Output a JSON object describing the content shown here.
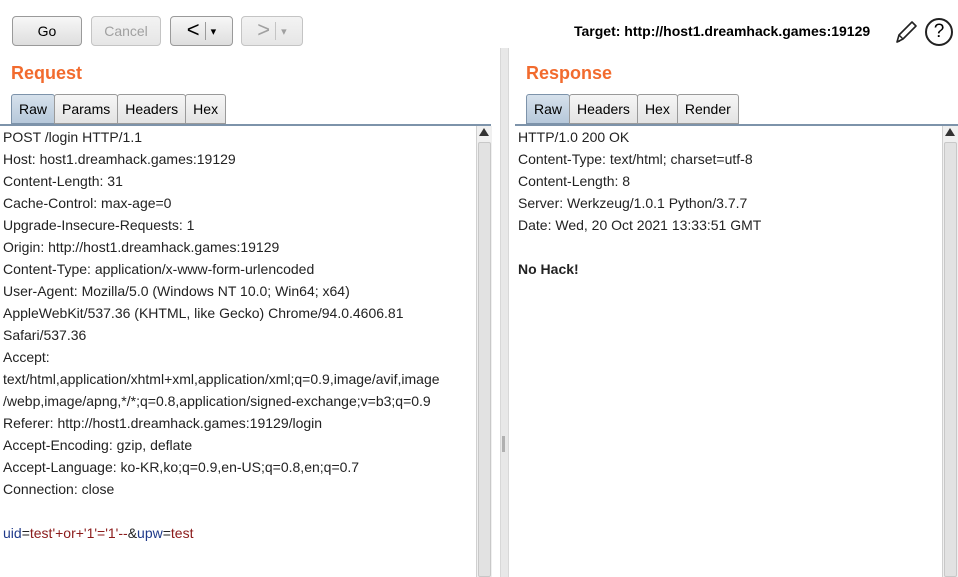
{
  "toolbar": {
    "go_label": "Go",
    "cancel_label": "Cancel",
    "back_arrow": "<",
    "forward_arrow": ">",
    "dropdown_glyph": "▾",
    "target_label": "Target: http://host1.dreamhack.games:19129"
  },
  "request": {
    "title": "Request",
    "tabs": [
      "Raw",
      "Params",
      "Headers",
      "Hex"
    ],
    "active_tab": "Raw",
    "lines": [
      "POST /login HTTP/1.1",
      "Host: host1.dreamhack.games:19129",
      "Content-Length: 31",
      "Cache-Control: max-age=0",
      "Upgrade-Insecure-Requests: 1",
      "Origin: http://host1.dreamhack.games:19129",
      "Content-Type: application/x-www-form-urlencoded",
      "User-Agent: Mozilla/5.0 (Windows NT 10.0; Win64; x64)",
      "AppleWebKit/537.36 (KHTML, like Gecko) Chrome/94.0.4606.81",
      "Safari/537.36",
      "Accept:",
      "text/html,application/xhtml+xml,application/xml;q=0.9,image/avif,image",
      "/webp,image/apng,*/*;q=0.8,application/signed-exchange;v=b3;q=0.9",
      "Referer: http://host1.dreamhack.games:19129/login",
      "Accept-Encoding: gzip, deflate",
      "Accept-Language: ko-KR,ko;q=0.9,en-US;q=0.8,en;q=0.7",
      "Connection: close",
      ""
    ],
    "body": {
      "key1": "uid",
      "eq1": "=",
      "val1": "test'+or+'1'='1'--",
      "amp": "&",
      "key2": "upw",
      "eq2": "=",
      "val2": "test"
    }
  },
  "response": {
    "title": "Response",
    "tabs": [
      "Raw",
      "Headers",
      "Hex",
      "Render"
    ],
    "active_tab": "Raw",
    "lines": [
      "HTTP/1.0 200 OK",
      "Content-Type: text/html; charset=utf-8",
      "Content-Length: 8",
      "Server: Werkzeug/1.0.1 Python/3.7.7",
      "Date: Wed, 20 Oct 2021 13:33:51 GMT",
      ""
    ],
    "body_text": "No Hack!"
  },
  "colors": {
    "title_orange": "#f26b2e",
    "tab_active": "#b6c8da",
    "param_key": "#1f3a8a",
    "param_value": "#8b1a1a"
  },
  "icons": [
    "pencil-icon",
    "help-icon",
    "back-arrow-icon",
    "forward-arrow-icon"
  ]
}
